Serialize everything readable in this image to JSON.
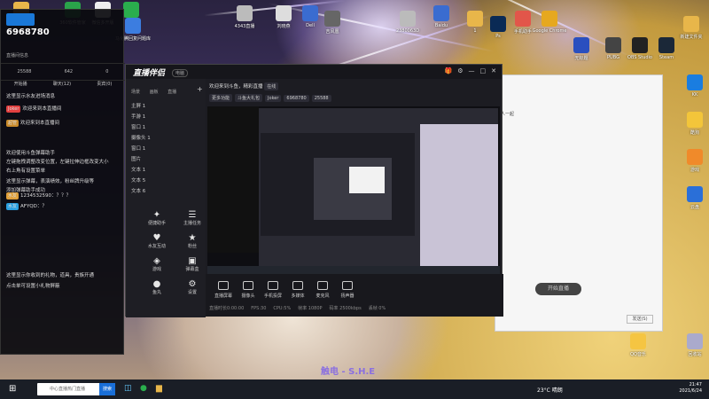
{
  "desktop": {
    "icons": [
      {
        "label": "工作/网络",
        "icon": "folder-icon",
        "color": "#e8b64a"
      },
      {
        "label": "360软件管家",
        "icon": "app-icon",
        "color": "#2aa34a"
      },
      {
        "label": "微信多开版",
        "icon": "app-icon",
        "color": "#eee"
      },
      {
        "label": "微信",
        "icon": "wechat-icon",
        "color": "#2aae4d"
      },
      {
        "label": "马化腾回复问题库",
        "icon": "doc-icon",
        "color": "#3c7de0"
      },
      {
        "label": "4343直播",
        "icon": "app-icon",
        "color": "#bbb"
      },
      {
        "label": "刘晓燕",
        "icon": "app-icon",
        "color": "#ddd"
      },
      {
        "label": "Dell",
        "icon": "app-icon",
        "color": "#3a6cd0"
      },
      {
        "label": "吉风凰",
        "icon": "app-icon",
        "color": "#666"
      },
      {
        "label": "2380063D",
        "icon": "app-icon",
        "color": "#bbb"
      },
      {
        "label": "Baidu",
        "icon": "app-icon",
        "color": "#3a6cd0"
      },
      {
        "label": "1",
        "icon": "folder-icon",
        "color": "#e8b64a"
      },
      {
        "label": "Ps",
        "icon": "app-icon",
        "color": "#0a2a55"
      },
      {
        "label": "手机助手",
        "icon": "app-icon",
        "color": "#e2564a"
      },
      {
        "label": "Google Chrome",
        "icon": "chrome-icon",
        "color": "#e6a81f"
      },
      {
        "label": "无标题",
        "icon": "app-icon",
        "color": "#2a4fbf"
      },
      {
        "label": "PUBG",
        "icon": "app-icon",
        "color": "#444"
      },
      {
        "label": "OBS Studio",
        "icon": "obs-icon",
        "color": "#222"
      },
      {
        "label": "Steam",
        "icon": "steam-icon",
        "color": "#1b2838"
      },
      {
        "label": "新建文件夹",
        "icon": "folder-icon",
        "color": "#e8b64a"
      },
      {
        "label": "KK",
        "icon": "app-icon",
        "color": "#1a7de0"
      },
      {
        "label": "酷狗",
        "icon": "app-icon",
        "color": "#f3c53a"
      },
      {
        "label": "游戏",
        "icon": "app-icon",
        "color": "#f08a2a"
      },
      {
        "label": "云盘",
        "icon": "app-icon",
        "color": "#2a6fd8"
      },
      {
        "label": "QQ音乐",
        "icon": "app-icon",
        "color": "#f5c542"
      },
      {
        "label": "回收站",
        "icon": "recycle-icon",
        "color": "#aac"
      }
    ]
  },
  "chat": {
    "room_id": "6968780",
    "logo": "斗鱼直播",
    "top_label": "直播间信息",
    "stats": [
      "25588",
      "642",
      "0"
    ],
    "tabs": [
      "开始播",
      "聊天(12)",
      "贵宾(0)"
    ],
    "messages": [
      {
        "text": "这里显示水友进场消息"
      },
      {
        "badge": "Joker",
        "badge_color": "#e24040",
        "text": "欢迎来到本直播间"
      },
      {
        "badge": "超管",
        "badge_color": "#c98a2a",
        "text": "欢迎来到本直播间"
      },
      {
        "text": "欢迎使用斗鱼弹幕助手"
      },
      {
        "text": "左键拖拽调整改变位置，左键拉伸边框改变大小"
      },
      {
        "text": "右上角有设置菜单"
      },
      {
        "text": "这里显示弹幕，表演绩效，粉丝牌升级等"
      },
      {
        "text": "添加弹幕助手成功"
      },
      {
        "badge": "水友",
        "badge_color": "#e0a03a",
        "text": "1234532590：？？？"
      },
      {
        "badge": "水友",
        "badge_color": "#2aa0e0",
        "text": "AFYQD：？"
      },
      {
        "text": "这里显示你收到的礼物，道具，贵族开通"
      },
      {
        "text": "点击单可设置小礼物屏蔽"
      }
    ]
  },
  "studio": {
    "brand": "直播伴侣",
    "brand_tag": "电脑",
    "side_tabs": [
      "场景",
      "画板",
      "直播"
    ],
    "scenes": [
      "主屏 1",
      "手游 1",
      "窗口 1",
      "摄像头 1",
      "窗口 1",
      "图片",
      "文本 1",
      "文本 5",
      "文本 6"
    ],
    "info_text": "欢迎来到斗鱼，精彩直播",
    "info_tag": "在线",
    "chips": [
      "更多功能",
      "斗鱼大礼包",
      "Joker",
      "6968780",
      "25588"
    ],
    "tools": [
      {
        "label": "便捷助手"
      },
      {
        "label": "主播任务"
      },
      {
        "label": "水友互动"
      },
      {
        "label": "粉丝"
      },
      {
        "label": "游戏"
      },
      {
        "label": "弹幕盒"
      },
      {
        "label": "鱼丸"
      },
      {
        "label": "设置"
      }
    ],
    "bottom": [
      {
        "label": "直播屏幕"
      },
      {
        "label": "摄像头"
      },
      {
        "label": "手机投屏"
      },
      {
        "label": "多媒体"
      },
      {
        "label": "麦克风"
      },
      {
        "label": "扬声器"
      }
    ],
    "go_live": "开始直播",
    "status": [
      "直播时长0:00:00",
      "FPS:30",
      "CPU:5%",
      "帧率 1080P",
      "码率 2500kbps",
      "丢帧 0%"
    ]
  },
  "taskbar": {
    "search_placeholder": "中心直播热门直播",
    "search_button": "搜索",
    "temperature": "23°C 晴朗",
    "time": "21:47",
    "date": "2021/6/24"
  },
  "wallpaper_text": "触电 - S.H.E"
}
